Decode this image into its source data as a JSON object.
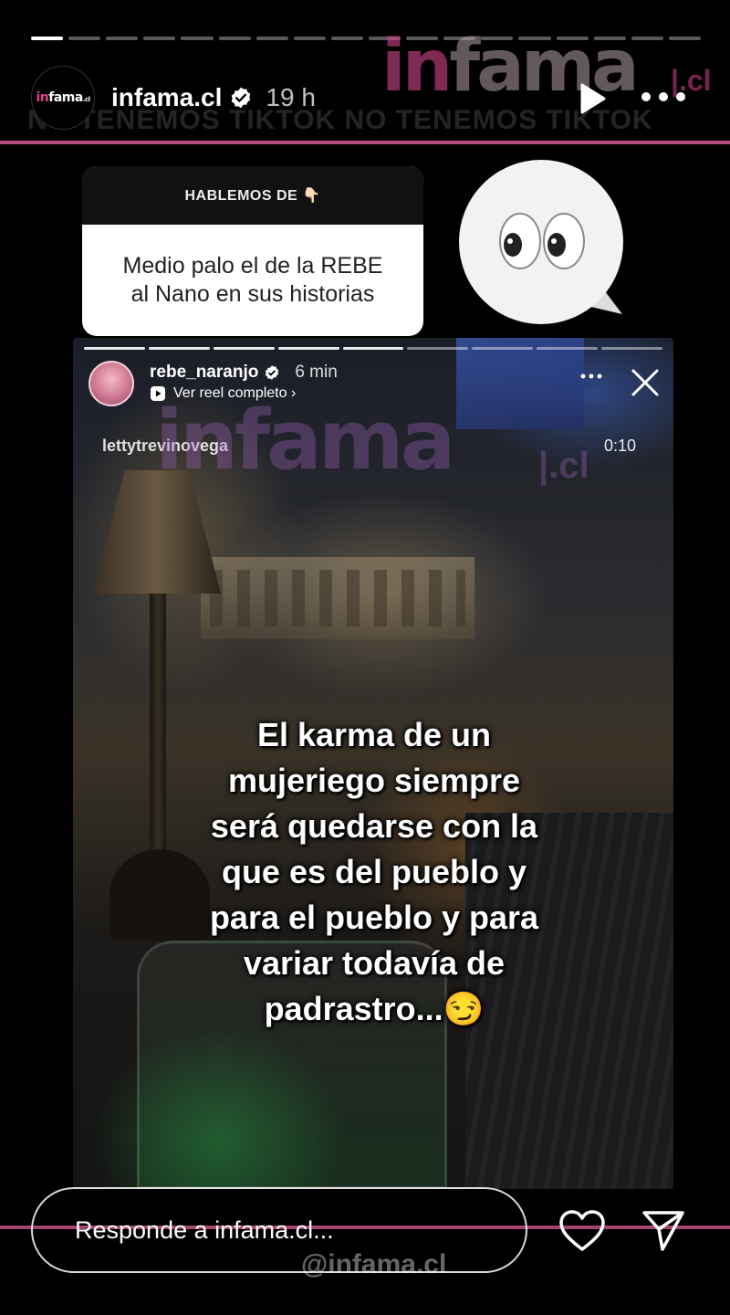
{
  "story": {
    "segments_total": 18,
    "segments_viewed": 1,
    "account": {
      "avatar_text": "infama.cl",
      "username": "infama.cl",
      "time": "19 h"
    },
    "watermark_brand": "infama",
    "watermark_suffix": "|.cl",
    "banner_text": "NO TENEMOS TIKTOK   NO TENEMOS TIKTOK",
    "accent_color": "#b64d79"
  },
  "question_sticker": {
    "header": "HABLEMOS DE 👇🏻",
    "body": "Medio palo el de  la REBE\nal Nano  en sus historias"
  },
  "emoji_sticker": {
    "icon": "eyes-icon"
  },
  "reel": {
    "username": "rebe_naranjo",
    "time": "6 min",
    "link_label": "Ver reel completo ›",
    "handle": "lettytrevinovega",
    "timer": "0:10",
    "caption": "El karma de un\nmujeriego siempre\nserá quedarse con la\nque es del pueblo y\npara el pueblo y para\nvariar todavía de\npadrastro...😏"
  },
  "footer": {
    "reply_placeholder": "Responde a infama.cl...",
    "watermark_handle": "@infama.cl"
  }
}
